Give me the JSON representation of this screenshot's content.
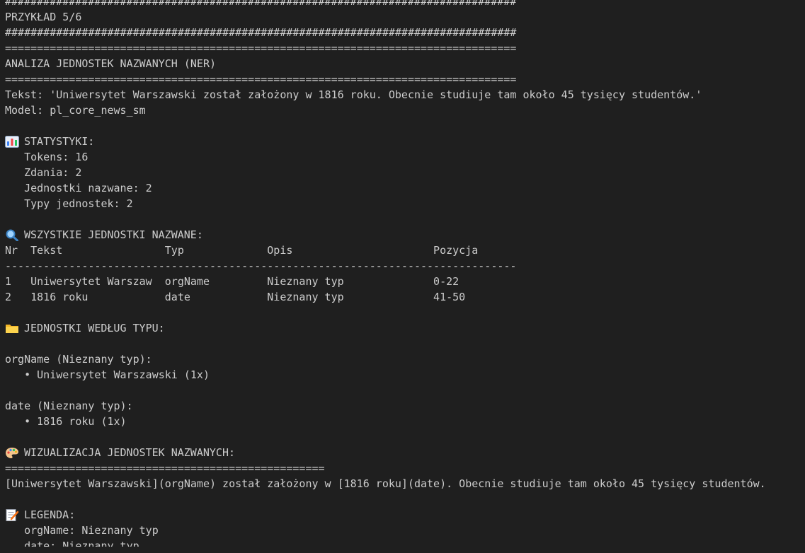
{
  "lines": [
    {
      "text": "################################################################################"
    },
    {
      "text": "PRZYKŁAD 5/6"
    },
    {
      "text": "################################################################################"
    },
    {
      "text": "================================================================================"
    },
    {
      "text": "ANALIZA JEDNOSTEK NAZWANYCH (NER)"
    },
    {
      "text": "================================================================================"
    },
    {
      "text": "Tekst: 'Uniwersytet Warszawski został założony w 1816 roku. Obecnie studiuje tam około 45 tysięcy studentów.'"
    },
    {
      "text": "Model: pl_core_news_sm"
    },
    {
      "text": ""
    },
    {
      "text": "STATYSTYKI:",
      "icon": "bar-chart-icon"
    },
    {
      "text": "   Tokens: 16"
    },
    {
      "text": "   Zdania: 2"
    },
    {
      "text": "   Jednostki nazwane: 2"
    },
    {
      "text": "   Typy jednostek: 2"
    },
    {
      "text": ""
    },
    {
      "text": "WSZYSTKIE JEDNOSTKI NAZWANE:",
      "icon": "magnifier-icon"
    },
    {
      "text": "Nr  Tekst                Typ             Opis                      Pozycja"
    },
    {
      "text": "--------------------------------------------------------------------------------"
    },
    {
      "text": "1   Uniwersytet Warszaw  orgName         Nieznany typ              0-22"
    },
    {
      "text": "2   1816 roku            date            Nieznany typ              41-50"
    },
    {
      "text": ""
    },
    {
      "text": "JEDNOSTKI WEDŁUG TYPU:",
      "icon": "folder-icon"
    },
    {
      "text": ""
    },
    {
      "text": "orgName (Nieznany typ):"
    },
    {
      "text": "   • Uniwersytet Warszawski (1x)"
    },
    {
      "text": ""
    },
    {
      "text": "date (Nieznany typ):"
    },
    {
      "text": "   • 1816 roku (1x)"
    },
    {
      "text": ""
    },
    {
      "text": "WIZUALIZACJA JEDNOSTEK NAZWANYCH:",
      "icon": "palette-icon"
    },
    {
      "text": "=================================================="
    },
    {
      "text": "[Uniwersytet Warszawski](orgName) został założony w [1816 roku](date). Obecnie studiuje tam około 45 tysięcy studentów."
    },
    {
      "text": ""
    },
    {
      "text": "LEGENDA:",
      "icon": "memo-icon"
    },
    {
      "text": "   orgName: Nieznany typ"
    },
    {
      "text": "   date: Nieznany typ"
    }
  ],
  "colors": {
    "background": "#1f1f1f",
    "text": "#cccccc"
  }
}
